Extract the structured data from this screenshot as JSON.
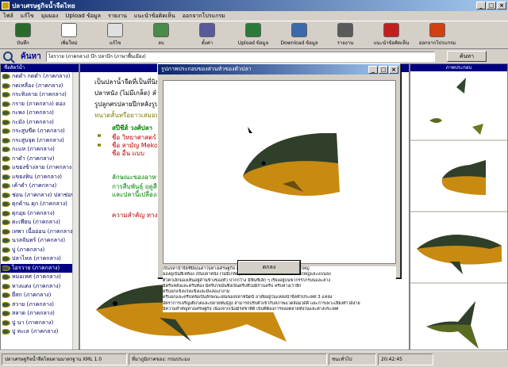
{
  "window": {
    "title": "ปลาเศรษฐกิจน้ำจืดไทย"
  },
  "menu": [
    "ไฟล์",
    "แก้ไข",
    "มุมมอง",
    "Upload ข้อมูล",
    "รายงาน",
    "แนะนำข้อคิดเห็น",
    "ออกจากโปรแกรม"
  ],
  "toolbar": [
    {
      "label": "บันทึก",
      "icon": "save-icon",
      "color": "#2a6a2a"
    },
    {
      "label": "เพิ่มใหม่",
      "icon": "new-document-icon",
      "color": "#ffffff"
    },
    {
      "label": "แก้ไข",
      "icon": "edit-icon",
      "color": "#e0e0e0"
    },
    {
      "label": "ลบ",
      "icon": "trash-icon",
      "color": "#4a8a4a"
    },
    {
      "label": "ตั้งค่า",
      "icon": "settings-icon",
      "color": "#5a5a9a"
    },
    {
      "label": "Upload ข้อมูล",
      "icon": "upload-globe-icon",
      "color": "#2a7a3a"
    },
    {
      "label": "Download ข้อมูล",
      "icon": "download-globe-icon",
      "color": "#3a6aaa"
    },
    {
      "label": "รายงาน",
      "icon": "print-icon",
      "color": "#5a5a5a"
    },
    {
      "label": "แนะนำข้อคิดเห็น",
      "icon": "help-icon",
      "color": "#c02020"
    },
    {
      "label": "ออกจากโปรแกรม",
      "icon": "exit-icon",
      "color": "#d04010"
    }
  ],
  "search": {
    "label": "ค้นหา",
    "value": "ไอรวาย (ภาคกลาง) บึก ปลาบึก (ภาษาพื้นเมือง)",
    "button": "ค้นหา"
  },
  "left_panel": {
    "header": "ชื่อสัตว์น้ำ",
    "items": [
      "กดดำ กดดำ (ภาคกลาง)",
      "กดเหลือง (ภาคกลาง)",
      "กระทิงลาย (ภาคกลาง)",
      "กราย (ภาคกลาง) ตอง",
      "กะพง (ภาคกลาง)",
      "กะมัง (ภาคกลาง)",
      "กระสูบขีด (ภาคกลาง)",
      "กระสูบจุด (ภาคกลาง)",
      "กะแห (ภาคกลาง)",
      "กาดำ (ภาคกลาง)",
      "แขยงข้างลาย (ภาคกลาง)",
      "แขยงหิน (ภาคกลาง)",
      "เค้าดำ (ภาคกลาง)",
      "ช่อน (ภาคกลาง) ปลาช่อน",
      "ดุกด้าน ดุก (ภาคกลาง)",
      "ดุกอุย (ภาคกลาง)",
      "ตะเพียน (ภาคกลาง)",
      "เทพา เนื้ออ่อน (ภาคกลาง)",
      "นวลจันทร์ (ภาคกลาง)",
      "บู่ (ภาคกลาง)",
      "ปลาไหล (ภาคกลาง)",
      "ไอรวาย (ภาคกลาง)",
      "หมอเทศ (ภาคกลาง)",
      "หางแดง (ภาคกลาง)",
      "ยี่สก (ภาคกลาง)",
      "สวาย (ภาคกลาง)",
      "สลาด (ภาคกลาง)",
      "ปู นา (ภาคกลาง)",
      "ปู ทะเล (ภาคกลาง)"
    ],
    "selected_index": 21
  },
  "content": {
    "line1": "เป็นปลาน้ำจืดที่เป็นที่นิยม",
    "line2": "ปลาหนัง (ไม่มีเกล็ด) ลำตัว",
    "line3": "รูปลูกศรปลายปีกหลังรูปลูก",
    "line4": "หนวดสั้นหรือยาวเสมอหน้า",
    "line5": "สปีชีส์ วงศ์ปลา",
    "line6": "ชื่อ วิทยาศาสตร์",
    "line7": "ชื่อ สามัญ Meko",
    "line8": "ชื่อ อื่น แบบ",
    "line9": "ลักษณะของอาหาร",
    "line10": "การสืบพันธุ์ ฤดูสืบ",
    "line11": "และปลานี้เปลืองอาหาร",
    "line12": "ความสำคัญ ทางเศรษฐกิจ"
  },
  "right_panel": {
    "header": "ภาพประกอบ"
  },
  "dialog": {
    "title": "รูปภาพประกอบของส่วนหัวของตัวปลา",
    "text": [
      "เป็นปลาน้ำจืดที่มีคุณค่าในทางเศรษฐกิจ ลำตัวยาวด้านข้างแบน ส่วนหัวแบนใหญ่",
      "มองดูเป็นสีเหลือง เป็นปลาหนัง (ไม่มีเกล็ด) ลำตัวค่อนข้างสั้น ส่วนหัวมีขนาดใหญ่และแบนลง",
      "ตัวตาเล็กมองเห็นอยู่ด้านข้างของหัว ปากกว้าง มีฟันซี่เล็ก ๆ เรียงอยู่บนขากรรไกรบนและล่าง",
      "มีครีบหลังและครีบท้อง มีครีบไขมันซึ่งเป็นครีบที่ไม่มีก้านครีบ ครีบหางเว้าลึก",
      "ครีบอกแข็งแรงแข็งและมีแสงเงางาม",
      "ครีบอกและครีบหลังเป็นลักษณะเด่นของปลาชนิดนี้ อาศัยอยู่ในแหล่งน้ำจืดทั่วประเทศ 3 แหล่ง",
      "อัตราการเจริญเติบโตและขยายพันธุ์สูง สามารถปรับตัวเข้ากับสภาพแวดล้อมได้ดี และการเพาะเลี้ยงทำได้ง่าย",
      "มีความสำคัญทางเศรษฐกิจ เนื่องจากเนื้อมีรสชาติดี เป็นที่ต้องการของตลาดทั้งในและต่างประเทศ"
    ],
    "ok": "ตกลง"
  },
  "status": {
    "left": "ปลาเศรษฐกิจน้ำจืดไทยตามมาตรฐาน XML 1.0",
    "middle": "ที่มาภูมิภาคของ: กรมประมง",
    "right": "ชนะทั่วไป",
    "time": "20:42:45"
  }
}
